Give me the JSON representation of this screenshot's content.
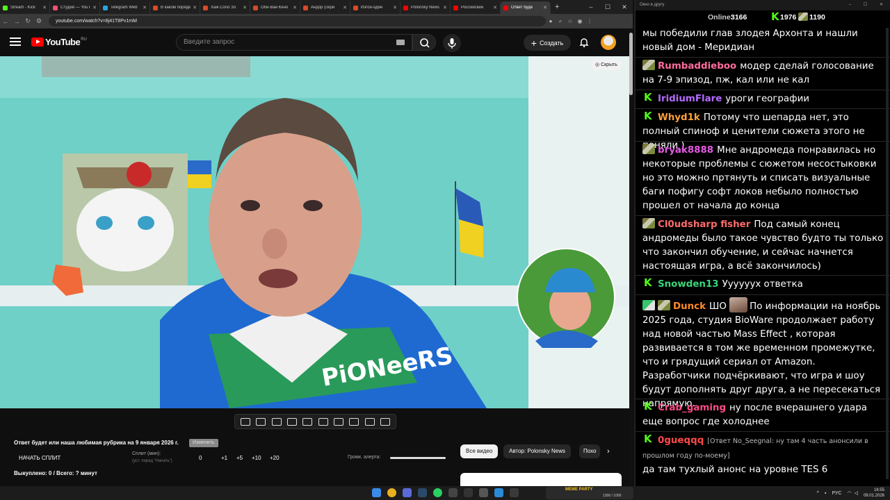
{
  "browser": {
    "tabs": [
      {
        "label": "Stream - Kick",
        "color": "#53fc18",
        "active": false
      },
      {
        "label": "Студия — YouTube",
        "color": "#ff4f6f",
        "active": false
      },
      {
        "label": "Telegram Web",
        "color": "#2aa3dc",
        "active": false
      },
      {
        "label": "В каком порядке",
        "color": "#d84a2a",
        "active": false
      },
      {
        "label": "Хаж Соло Зо",
        "color": "#d84a2a",
        "active": false
      },
      {
        "label": "Оби-Ван Кено",
        "color": "#d84a2a",
        "active": false
      },
      {
        "label": "Андор (сери",
        "color": "#d84a2a",
        "active": false
      },
      {
        "label": "Изгой-один",
        "color": "#d84a2a",
        "active": false
      },
      {
        "label": "Polonsky News",
        "color": "#ff0000",
        "active": false
      },
      {
        "label": "Российский",
        "color": "#ff0000",
        "active": false
      },
      {
        "label": "Ответ буде",
        "color": "#ff0000",
        "active": true
      }
    ],
    "url": "youtube.com/watch?v=8j41T8Pv1mM"
  },
  "youtube": {
    "logo_text": "YouTube",
    "region": "RU",
    "search_placeholder": "Введите запрос",
    "create_label": "Создать",
    "hide_label": "Скрыть"
  },
  "below": {
    "title": "Ответ будет или наша любимая рубрика на 9 января 2026 г.",
    "tag": "Изменить",
    "split_button": "НАЧАТЬ СПЛИТ",
    "split_label": "Сплит (мин):",
    "split_sub": "(уст. перед \"Начать\")",
    "split_values": [
      "0",
      "+1",
      "+5",
      "+10",
      "+20"
    ],
    "alert_label": "Громк. алерта:",
    "bought": "Выкуплено: 0 / Всего: ? минут",
    "chips": [
      "Все видео",
      "Автор: Polonsky News",
      "Похо"
    ]
  },
  "chat": {
    "window_title": "Окно в другу",
    "online_label": "Online:",
    "online_count": "3166",
    "stat_a": "1976",
    "stat_b": "1190",
    "messages": [
      {
        "badge": "",
        "user": "",
        "color": "#ffffff",
        "text": "мы победили глав злодея Архонта и нашли новый дом - Меридиан"
      },
      {
        "badge": "sword",
        "user": "Rumbaddieboo",
        "color": "#ff6b9e",
        "text": "модер сделай голосование на 7-9 эпизод, пж, кал или не кал"
      },
      {
        "badge": "k",
        "user": "IridiumFlare",
        "color": "#b36bff",
        "text": "уроги географии"
      },
      {
        "badge": "k",
        "user": "Whyd1k",
        "color": "#ffa23a",
        "text": "Потому что шепарда нет, это полный спиноф и ценители сюжета этого не поняли )"
      },
      {
        "badge": "sword",
        "user": "bryak8888",
        "color": "#e35ae3",
        "text": "Мне андромеда понравилась но некоторые проблемы с сюжетом несостыковки но это можно пртянуть и списать визуальные баги пофигу софт локов небыло полностью прошел от начала до конца"
      },
      {
        "badge": "sword",
        "user": "Cl0udsharp fisher",
        "color": "#ff6b6b",
        "text": "Под самый конец андромеды было такое чувство будто ты только что закончил обучение, и сейчас начнется настоящая игра, а всё закончилось)"
      },
      {
        "badge": "k",
        "user": "Snowden13",
        "color": "#3ad67a",
        "text": "Уууууух ответка"
      },
      {
        "badge": "pen",
        "user": "Dunck",
        "color": "#ff8a2a",
        "text": "ШО",
        "text2": "По информации на ноябрь 2025 года, студия BioWare продолжает работу над новой частью Mass Effect , которая развивается в том же временном промежутке, что и грядущий сериал от Amazon. Разработчики подчёркивают, что игра и шоу будут дополнять друг друга, а не пересекаться напрямую."
      },
      {
        "badge": "k",
        "user": "Crab_gaming",
        "color": "#ff4a8a",
        "text": "ну после вчерашнего удара еще вопрос где холоднее"
      },
      {
        "badge": "k",
        "user": "0gueqqq",
        "color": "#ff4a4a",
        "reply": "[Ответ No_Seegnal: ну там 4 часть анонсили в прошлом году по-моему]",
        "text": "да там тухлый анонс на уровне TES 6"
      }
    ]
  },
  "taskbar": {
    "widget_text": "МЕМЕ PARTY",
    "widget_count": "1306 / 1000",
    "lang": "РУС",
    "time": "16:55",
    "date": "09.01.2026"
  }
}
